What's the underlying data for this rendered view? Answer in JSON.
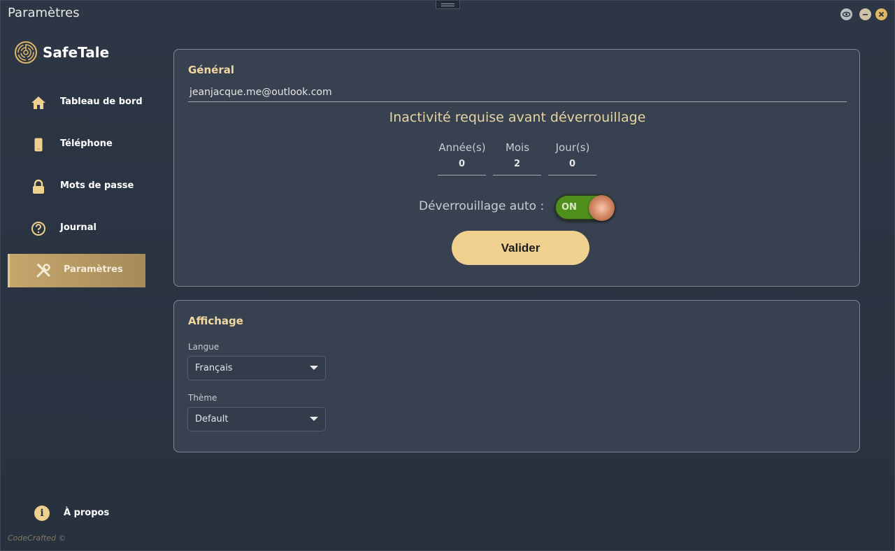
{
  "window": {
    "title": "Paramètres"
  },
  "brand": {
    "name": "SafeTale"
  },
  "sidebar": {
    "items": [
      {
        "label": "Tableau de bord",
        "icon": "home-icon"
      },
      {
        "label": "Téléphone",
        "icon": "phone-icon"
      },
      {
        "label": "Mots de passe",
        "icon": "lock-icon"
      },
      {
        "label": "Journal",
        "icon": "question-icon"
      },
      {
        "label": "Paramètres",
        "icon": "tools-icon",
        "active": true
      }
    ],
    "about": {
      "label": "À propos",
      "icon": "info-icon"
    },
    "copyright": "CodeCrafted ©"
  },
  "general": {
    "title": "Général",
    "email": "jeanjacque.me@outlook.com",
    "inactivity_title": "Inactivité requise avant déverrouillage",
    "duration": {
      "years_label": "Année(s)",
      "years_value": "0",
      "months_label": "Mois",
      "months_value": "2",
      "days_label": "Jour(s)",
      "days_value": "0"
    },
    "auto_unlock_label": "Déverrouillage auto :",
    "auto_unlock_state": "ON",
    "submit_label": "Valider"
  },
  "display": {
    "title": "Affichage",
    "language_label": "Langue",
    "language_value": "Français",
    "theme_label": "Thème",
    "theme_value": "Default"
  },
  "colors": {
    "accent": "#f0d08e",
    "toggle_on": "#4f8f1c",
    "background": "#2a3341",
    "card": "#374150"
  }
}
